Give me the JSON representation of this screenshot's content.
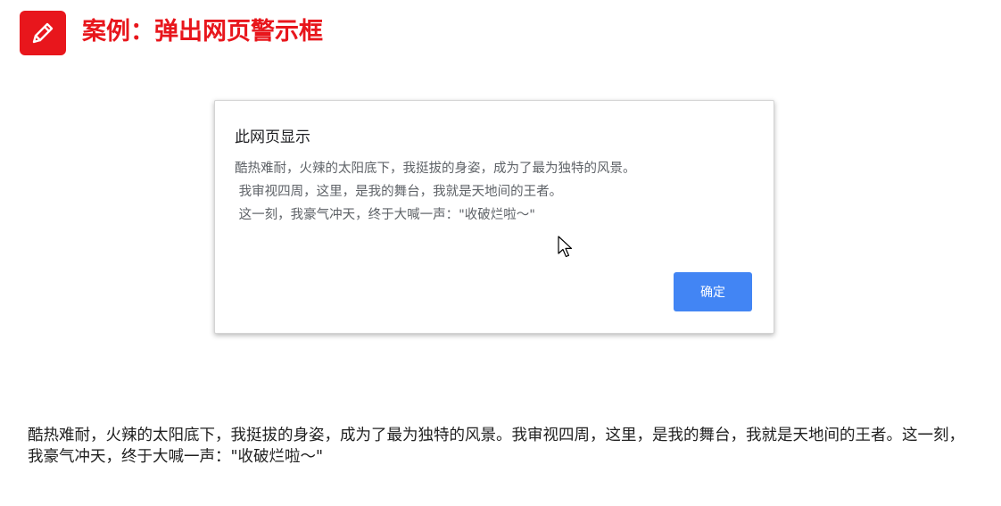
{
  "header": {
    "title": "案例：弹出网页警示框",
    "icon": "pencil-icon",
    "accent_color": "#e8161c"
  },
  "dialog": {
    "title": "此网页显示",
    "message": "酷热难耐，火辣的太阳底下，我挺拔的身姿，成为了最为独特的风景。\n 我审视四周，这里，是我的舞台，我就是天地间的王者。\n 这一刻，我豪气冲天，终于大喊一声：\"收破烂啦～\"",
    "ok_label": "确定",
    "button_color": "#4285f4"
  },
  "body": {
    "text": "酷热难耐，火辣的太阳底下，我挺拔的身姿，成为了最为独特的风景。我审视四周，这里，是我的舞台，我就是天地间的王者。这一刻，我豪气冲天，终于大喊一声：\"收破烂啦～\""
  },
  "cursor": {
    "icon": "mouse-pointer-icon"
  }
}
